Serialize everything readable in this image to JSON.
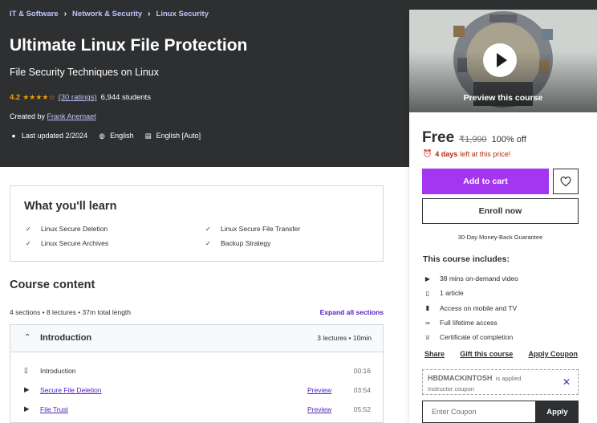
{
  "breadcrumb": [
    "IT & Software",
    "Network & Security",
    "Linux Security"
  ],
  "course": {
    "title": "Ultimate Linux File Protection",
    "subtitle": "File Security Techniques on Linux",
    "rating": "4.2",
    "ratings_link": "(30 ratings)",
    "students": "6,944 students",
    "created_prefix": "Created by",
    "author": "Frank Anemaet",
    "updated": "Last updated 2/2024",
    "language": "English",
    "captions": "English [Auto]"
  },
  "sidebar": {
    "preview_label": "Preview this course",
    "price": "Free",
    "original_price": "₹1,990",
    "discount": "100% off",
    "timer_bold": "4 days",
    "timer_rest": "left at this price!",
    "add_to_cart": "Add to cart",
    "enroll": "Enroll now",
    "guarantee": "30-Day Money-Back Guarantee",
    "includes_title": "This course includes:",
    "includes": [
      {
        "icon": "video-icon",
        "text": "38 mins on-demand video"
      },
      {
        "icon": "file-icon",
        "text": "1 article"
      },
      {
        "icon": "mobile-icon",
        "text": "Access on mobile and TV"
      },
      {
        "icon": "infinity-icon",
        "text": "Full lifetime access"
      },
      {
        "icon": "trophy-icon",
        "text": "Certificate of completion"
      }
    ],
    "share": "Share",
    "gift": "Gift this course",
    "apply_coupon_link": "Apply Coupon",
    "coupon_code": "HBDMACKINTOSH",
    "coupon_applied": "is applied",
    "coupon_type": "Instructor coupon",
    "coupon_placeholder": "Enter Coupon",
    "apply": "Apply"
  },
  "learn": {
    "title": "What you'll learn",
    "items": [
      "Linux Secure Deletion",
      "Linux Secure File Transfer",
      "Linux Secure Archives",
      "Backup Strategy"
    ]
  },
  "content": {
    "title": "Course content",
    "summary": "4 sections • 8 lectures • 37m total length",
    "expand": "Expand all sections",
    "section": {
      "name": "Introduction",
      "stats": "3 lectures • 10min",
      "lectures": [
        {
          "name": "Introduction",
          "preview": "",
          "duration": "00:16"
        },
        {
          "name": "Secure File Deletion",
          "preview": "Preview",
          "duration": "03:54"
        },
        {
          "name": "File Trust",
          "preview": "Preview",
          "duration": "05:52"
        }
      ]
    }
  },
  "colors": {
    "hero_bg": "#2d2f31",
    "accent": "#a435f0",
    "link_light": "#c0c4fc",
    "link": "#5022c3",
    "star": "#f69c08",
    "timer": "#b32d0f"
  }
}
